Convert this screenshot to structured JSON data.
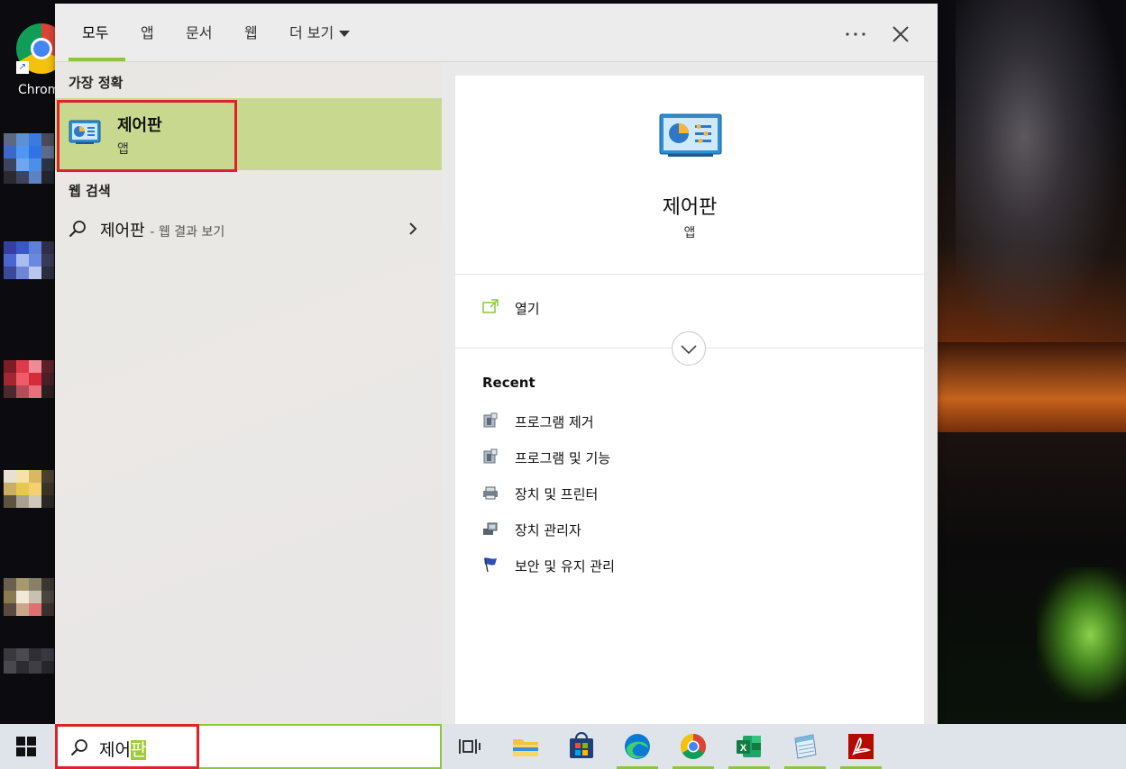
{
  "desktop": {
    "chrome_shortcut_label": "Chrom"
  },
  "search_panel": {
    "tabs": [
      "모두",
      "앱",
      "문서",
      "웹",
      "더 보기"
    ],
    "active_tab": "모두",
    "more_options_icon": "ellipsis-icon",
    "close_icon": "close-icon",
    "best_match": {
      "section_title": "가장 정확",
      "title": "제어판",
      "subtitle": "앱"
    },
    "web_search": {
      "section_title": "웹 검색",
      "query": "제어판",
      "suffix": "- 웹 결과 보기"
    },
    "preview": {
      "title": "제어판",
      "subtitle": "앱",
      "open_label": "열기",
      "recent_title": "Recent",
      "recent_items": [
        {
          "label": "프로그램 제거",
          "icon": "programs-icon"
        },
        {
          "label": "프로그램 및 기능",
          "icon": "programs-icon"
        },
        {
          "label": "장치 및 프린터",
          "icon": "printer-icon"
        },
        {
          "label": "장치 관리자",
          "icon": "device-manager-icon"
        },
        {
          "label": "보안 및 유지 관리",
          "icon": "security-flag-icon"
        }
      ]
    }
  },
  "taskbar": {
    "search_text": "제어",
    "search_text_highlight": "판",
    "pinned": [
      "task-view-icon",
      "file-explorer-icon",
      "microsoft-store-icon",
      "edge-icon",
      "chrome-icon",
      "excel-icon",
      "notepad-icon",
      "acrobat-icon"
    ],
    "accent_color": "#8cc63f"
  },
  "colors": {
    "highlight_frame": "#e0202a",
    "best_match_bg": "#c8d98f"
  }
}
